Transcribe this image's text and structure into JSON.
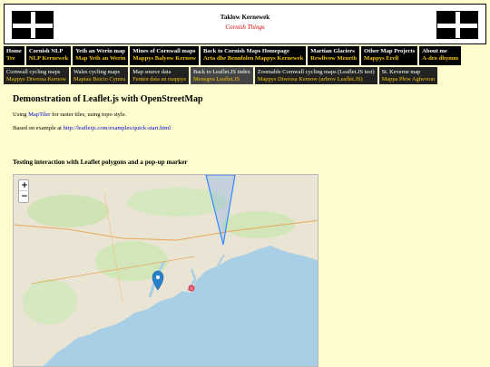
{
  "header": {
    "title": "Taklow Kernewek",
    "subtitle": "Cornish Things"
  },
  "nav_primary": [
    {
      "line1": "Home",
      "line2": "Tre"
    },
    {
      "line1": "Cornish NLP",
      "line2": "NLP Kernewek"
    },
    {
      "line1": "Yeth an Werin map",
      "line2": "Map Yeth an Werin"
    },
    {
      "line1": "Mines of Cornwall maps",
      "line2": "Mappys Balyow Kernow"
    },
    {
      "line1": "Back to Cornish Maps Homepage",
      "line2": "Arta dhe Bennfolen Mappys Kernewek"
    },
    {
      "line1": "Martian Glaciers",
      "line2": "Rewlivow Meurth"
    },
    {
      "line1": "Other Map Projects",
      "line2": "Mappys Erell"
    },
    {
      "line1": "About me",
      "line2": "A-dro dhymm"
    }
  ],
  "nav_secondary": [
    {
      "line1": "Cornwall cycling maps",
      "line2": "Mappys Diwrosa Kernow"
    },
    {
      "line1": "Wales cycling maps",
      "line2": "Mapiau Beicio Cymru"
    },
    {
      "line1": "Map source data",
      "line2": "Fenten data an mappys"
    },
    {
      "line1": "Back to Leaflet.JS index",
      "line2": "Menegva Leaflet.JS"
    },
    {
      "line1": "Zoomable Cornwall cycling maps (Leaflet.JS test)",
      "line2": "Mappys Diwrosa Kernow (arbrov Leaflet.JS)"
    },
    {
      "line1": "St. Keverne map",
      "line2": "Mappa Plew Aghevran"
    }
  ],
  "content": {
    "heading": "Demonstration of Leaflet.js with OpenStreetMap",
    "p1_prefix": "Using ",
    "p1_link": "MapTiler",
    "p1_suffix": " for raster tiles, using topo style.",
    "p2_prefix": "Based on example at ",
    "p2_link": "http://leafletjs.com/examples/quick-start.html",
    "section_heading": "Testing interaction with Leaflet polygons and a pop-up marker"
  },
  "map": {
    "zoom_in": "+",
    "zoom_out": "−",
    "colors": {
      "sea": "#a8cfe6",
      "land": "#e9e4d4",
      "green": "#cfe3b4",
      "polygon": "#3388ff",
      "marker": "#2a81cb",
      "circle": "#e03030"
    }
  }
}
